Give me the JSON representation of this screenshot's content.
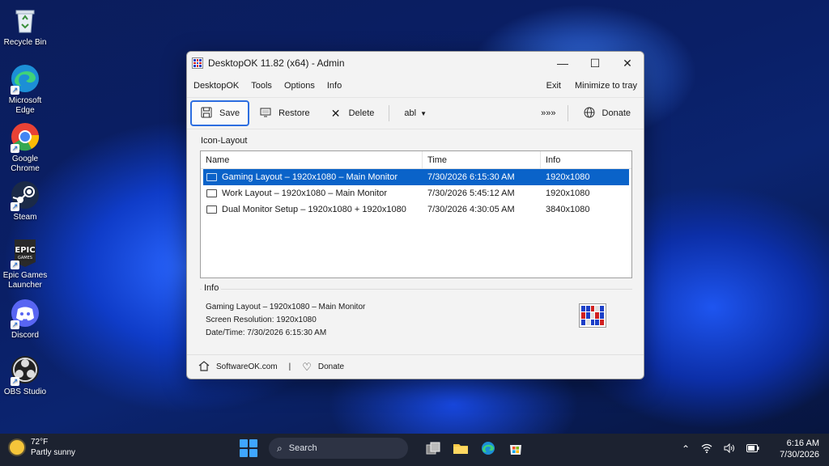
{
  "desktop": {
    "icons": [
      {
        "label": "Recycle Bin"
      },
      {
        "label": "Microsoft Edge"
      },
      {
        "label": "Google Chrome"
      },
      {
        "label": "Steam"
      },
      {
        "label": "Epic Games Launcher"
      },
      {
        "label": "Discord"
      },
      {
        "label": "OBS Studio"
      }
    ]
  },
  "window": {
    "title": "DesktopOK 11.82 (x64) - Admin",
    "controls": {
      "minimize": "—",
      "maximize": "☐",
      "close": "✕"
    },
    "menu": {
      "items": [
        "DesktopOK",
        "Tools",
        "Options",
        "Info"
      ],
      "right": [
        "Exit",
        "Minimize to tray"
      ]
    },
    "toolbar": {
      "save": "Save",
      "restore": "Restore",
      "delete": "Delete",
      "font_dropdown": "abl",
      "more": "»»»",
      "donate": "Donate"
    },
    "layout_group": "Icon-Layout",
    "columns": {
      "name": "Name",
      "time": "Time",
      "info": "Info"
    },
    "rows": [
      {
        "name": "Gaming Layout – 1920x1080 – Main Monitor",
        "time": "7/30/2026 6:15:30 AM",
        "info": "1920x1080",
        "selected": true
      },
      {
        "name": "Work Layout – 1920x1080 – Main Monitor",
        "time": "7/30/2026 5:45:12 AM",
        "info": "1920x1080",
        "selected": false
      },
      {
        "name": "Dual Monitor Setup – 1920x1080 + 1920x1080",
        "time": "7/30/2026 4:30:05 AM",
        "info": "3840x1080",
        "selected": false
      }
    ],
    "info_group": "Info",
    "info_lines": {
      "line1": "Gaming Layout – 1920x1080 – Main Monitor",
      "line2": "Screen Resolution: 1920x1080",
      "line3": "Date/Time: 7/30/2026 6:15:30 AM"
    },
    "footer": {
      "site": "SoftwareOK.com",
      "separator": "|",
      "donate": "Donate"
    }
  },
  "taskbar": {
    "weather": {
      "temp": "72°F",
      "condition": "Partly sunny"
    },
    "search_label": "Search",
    "clock": {
      "time": "6:16 AM",
      "date": "7/30/2026"
    }
  },
  "colors": {
    "accent": "#0a63c9",
    "taskbar": "#1c2230"
  }
}
